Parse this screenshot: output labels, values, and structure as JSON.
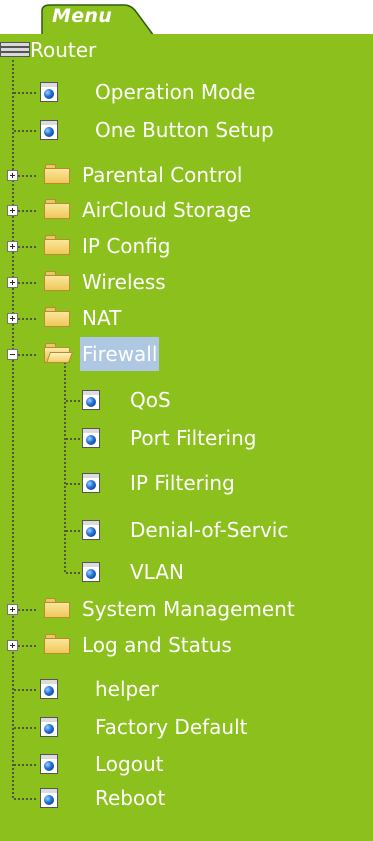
{
  "menu_tab": "Menu",
  "root": "Router",
  "items": [
    {
      "label": "Operation Mode"
    },
    {
      "label": "One Button Setup"
    },
    {
      "label": "Parental Control"
    },
    {
      "label": "AirCloud Storage"
    },
    {
      "label": "IP Config"
    },
    {
      "label": "Wireless"
    },
    {
      "label": "NAT"
    },
    {
      "label": "Firewall"
    },
    {
      "label": "QoS"
    },
    {
      "label": "Port Filtering"
    },
    {
      "label": "IP Filtering"
    },
    {
      "label": "Denial-of-Servic"
    },
    {
      "label": "VLAN"
    },
    {
      "label": "System Management"
    },
    {
      "label": "Log and Status"
    },
    {
      "label": "helper"
    },
    {
      "label": "Factory Default"
    },
    {
      "label": "Logout"
    },
    {
      "label": "Reboot"
    }
  ],
  "colors": {
    "panel": "#8cc01c",
    "tab": "#8cc01c",
    "selected_highlight": "#aec7e3"
  }
}
